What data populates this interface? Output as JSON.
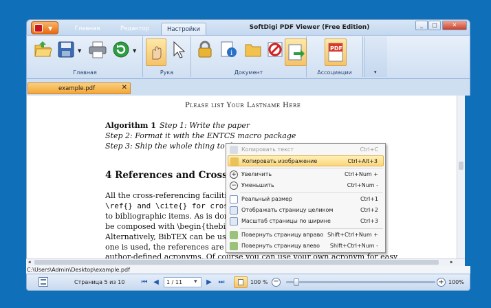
{
  "window": {
    "title": "SoftDigi PDF Viewer (Free Edition)"
  },
  "ribbon": {
    "tabs": [
      "Главная",
      "Редактор",
      "Настройки"
    ],
    "groups": {
      "home": "Главная",
      "hand": "Рука",
      "document": "Документ",
      "assoc": "Ассоциации"
    }
  },
  "doc_tab": {
    "name": "example.pdf"
  },
  "document": {
    "header": "Please list Your Lastname Here",
    "algo_bold": "Algorithm 1",
    "algo_step1": "Step 1: Write the paper",
    "algo_step2": "Step 2: Format it with the ENTCS macro package",
    "algo_step3": "Step 3: Ship the whole thing to th",
    "section": "4   References and Cross",
    "lines": [
      "All the cross-referencing facilities",
      "\\ref{} and \\cite{} for cross-ref",
      "to bibliographic items. As is done",
      "be composed with \\begin{thebi",
      "Alternatively, BibTEX can be use",
      "one is used, the references are to",
      "author-defined acronyms. Of course you can use your own acronym for easy"
    ]
  },
  "context_menu": {
    "items": [
      {
        "label": "Копировать текст",
        "shortcut": "Ctrl+C",
        "disabled": true
      },
      {
        "label": "Копировать изображение",
        "shortcut": "Ctrl+Alt+3",
        "highlighted": true
      },
      {
        "label": "Увеличить",
        "shortcut": "Ctrl+Num +"
      },
      {
        "label": "Уменьшить",
        "shortcut": "Ctrl+Num -"
      },
      {
        "label": "Реальный размер",
        "shortcut": "Ctrl+1"
      },
      {
        "label": "Отображать страницу целиком",
        "shortcut": "Ctrl+2"
      },
      {
        "label": "Масштаб страницы по ширине",
        "shortcut": "Ctrl+3"
      },
      {
        "label": "Повернуть страницу вправо",
        "shortcut": "Shift+Ctrl+Num +"
      },
      {
        "label": "Повернуть страницу влево",
        "shortcut": "Shift+Ctrl+Num -"
      }
    ]
  },
  "path": "C:\\Users\\Admin\\Desktop\\example.pdf",
  "status": {
    "page_info": "Страница 5 из 10",
    "page_field": "1 / 11",
    "zoom": "100 %",
    "zoom_right": "100%",
    "zoom_level": 0.05
  },
  "colors": {
    "accent": "#f3a63b",
    "ribbon": "#cfdff2",
    "frame": "#0f6fb8"
  }
}
